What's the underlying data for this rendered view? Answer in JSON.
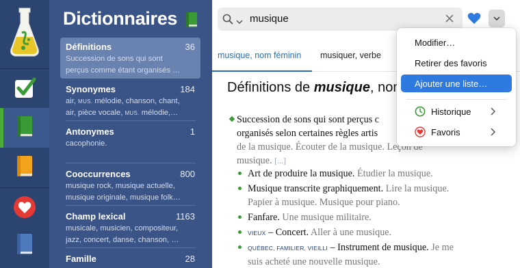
{
  "rail": {
    "items": [
      {
        "icon": "flask-app-icon"
      },
      {
        "icon": "checkmark-icon"
      },
      {
        "icon": "green-book-icon"
      },
      {
        "icon": "orange-book-icon"
      },
      {
        "icon": "heart-icon"
      },
      {
        "icon": "blue-book-icon"
      }
    ]
  },
  "dictionaries": {
    "title": "Dictionnaires",
    "entries": [
      {
        "name": "Définitions",
        "count": "36",
        "line1": "Succession de sons qui sont",
        "line2": "perçus comme étant organisés …"
      },
      {
        "name": "Synonymes",
        "count": "184",
        "line1_a": "air, ",
        "line1_tag": "MUS.",
        "line1_b": " mélodie, chanson, chant,",
        "line2_a": "air, pièce vocale, ",
        "line2_tag": "MUS.",
        "line2_b": " mélodie,…"
      },
      {
        "name": "Antonymes",
        "count": "1",
        "line1": "cacophonie."
      },
      {
        "name": "Cooccurrences",
        "count": "800",
        "line1": "musique rock, musique actuelle,",
        "line2": "musique originale, musique folk…"
      },
      {
        "name": "Champ lexical",
        "count": "1163",
        "line1": "musicale, musicien, compositeur,",
        "line2": "jazz, concert, danse, chanson, …"
      },
      {
        "name": "Famille",
        "count": "28"
      }
    ]
  },
  "search": {
    "value": "musique"
  },
  "tabs": [
    {
      "label": "musique, nom féminin"
    },
    {
      "label": "musiquer, verbe"
    }
  ],
  "definition": {
    "title_prefix": "Définitions de ",
    "title_word": "musique",
    "title_suffix": ", nom",
    "main_line1": "Succession de sons qui sont perçus c",
    "main_line2": "organisés selon certaines règles artis",
    "main_ex_line3": "de la musique. Écouter de la musique. Leçon de",
    "main_ex_line4": "musique.",
    "main_ellipsis": "[...]",
    "subs": [
      {
        "text": "Art de produire la musique.",
        "example": " Étudier la musique."
      },
      {
        "text": "Musique transcrite graphiquement.",
        "example": " Lire la musique.",
        "example2": "Papier à musique. Musique pour piano."
      },
      {
        "text": "Fanfare.",
        "example": " Une musique militaire."
      },
      {
        "tags": "VIEUX",
        "text": " – Concert.",
        "example": " Aller à une musique."
      },
      {
        "tags": "QUÉBEC, FAMILIER, VIEILLI",
        "text": " – Instrument de musique.",
        "example": " Je me",
        "example2": "suis acheté une nouvelle musique."
      }
    ]
  },
  "menu": {
    "items": [
      {
        "label": "Modifier…"
      },
      {
        "label": "Retirer des favoris"
      },
      {
        "label": "Ajouter une liste…",
        "highlighted": true
      },
      {
        "label": "Historique",
        "icon": "clock-icon"
      },
      {
        "label": "Favoris",
        "icon": "heart-icon"
      }
    ]
  },
  "colors": {
    "rail_bg": "#2c4470",
    "list_bg": "#3b5487",
    "accent_green": "#4caf37",
    "link_blue": "#2b6fb3",
    "highlight_blue": "#2e7ae0",
    "heart_red": "#e53935"
  }
}
